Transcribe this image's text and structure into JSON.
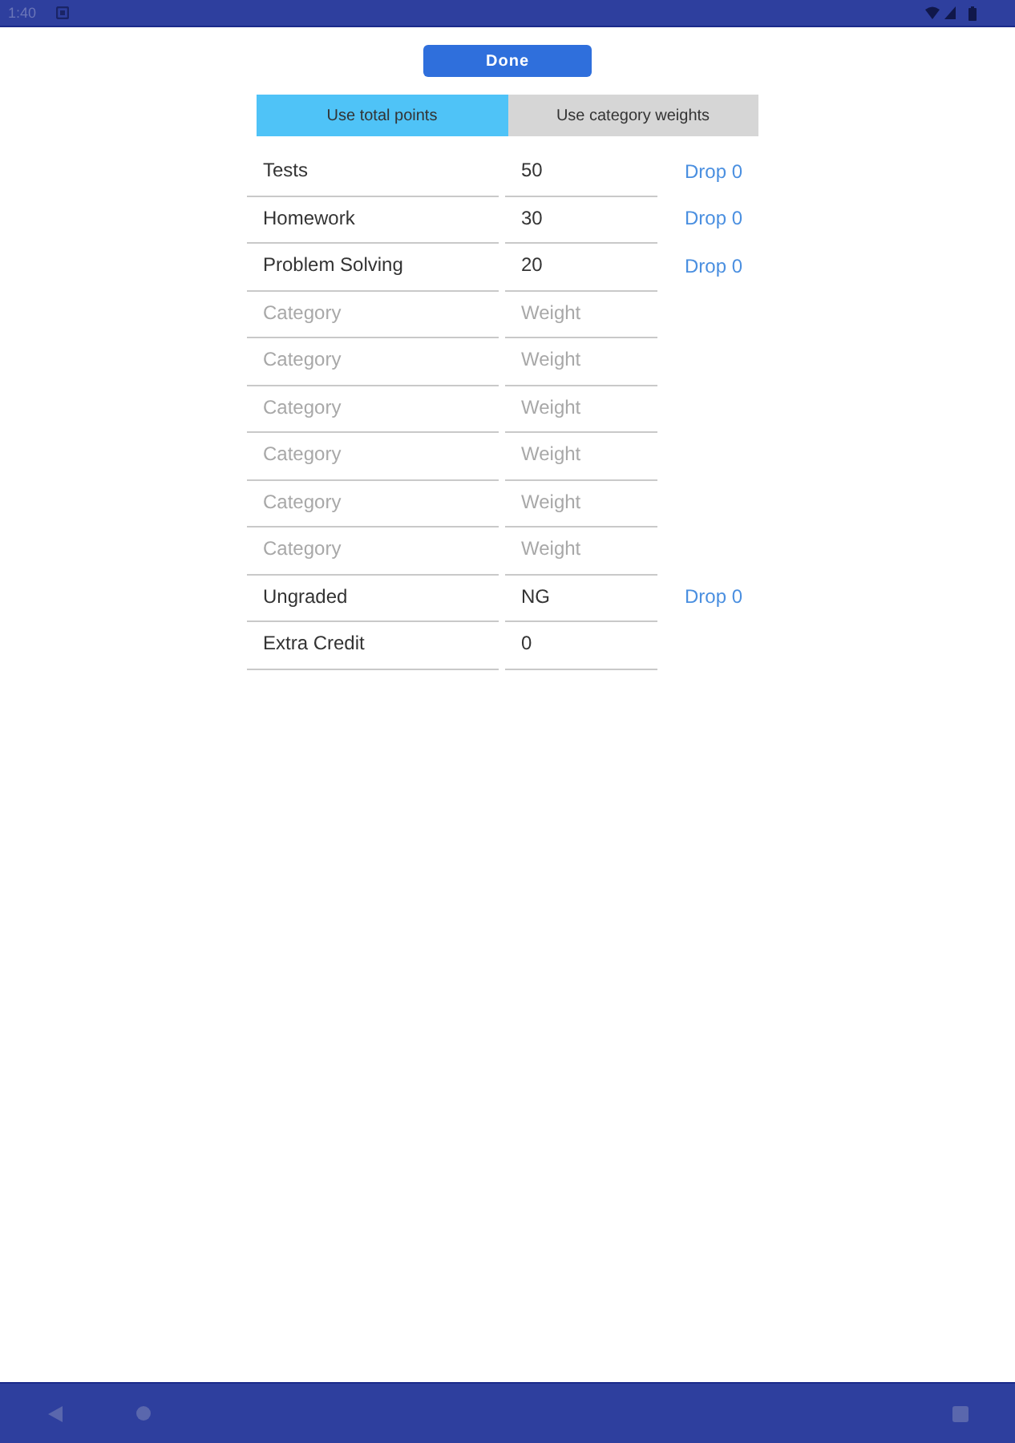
{
  "status_bar": {
    "time": "1:40"
  },
  "done_button": {
    "label": "Done"
  },
  "tabs": [
    {
      "label": "Use total points",
      "selected": true
    },
    {
      "label": "Use category weights",
      "selected": false
    }
  ],
  "rows": [
    {
      "category": {
        "value": "Tests"
      },
      "weight": {
        "value": "50"
      },
      "drop": "Drop 0"
    },
    {
      "category": {
        "value": "Homework"
      },
      "weight": {
        "value": "30"
      },
      "drop": "Drop 0"
    },
    {
      "category": {
        "value": "Problem Solving"
      },
      "weight": {
        "value": "20"
      },
      "drop": "Drop 0"
    },
    {
      "category": {
        "placeholder": "Category"
      },
      "weight": {
        "placeholder": "Weight"
      }
    },
    {
      "category": {
        "placeholder": "Category"
      },
      "weight": {
        "placeholder": "Weight"
      }
    },
    {
      "category": {
        "placeholder": "Category"
      },
      "weight": {
        "placeholder": "Weight"
      }
    },
    {
      "category": {
        "placeholder": "Category"
      },
      "weight": {
        "placeholder": "Weight"
      }
    },
    {
      "category": {
        "placeholder": "Category"
      },
      "weight": {
        "placeholder": "Weight"
      }
    },
    {
      "category": {
        "placeholder": "Category"
      },
      "weight": {
        "placeholder": "Weight"
      }
    },
    {
      "category": {
        "value": "Ungraded"
      },
      "weight": {
        "value": "NG"
      },
      "drop": "Drop 0"
    },
    {
      "category": {
        "value": "Extra Credit"
      },
      "weight": {
        "value": "0"
      }
    }
  ]
}
